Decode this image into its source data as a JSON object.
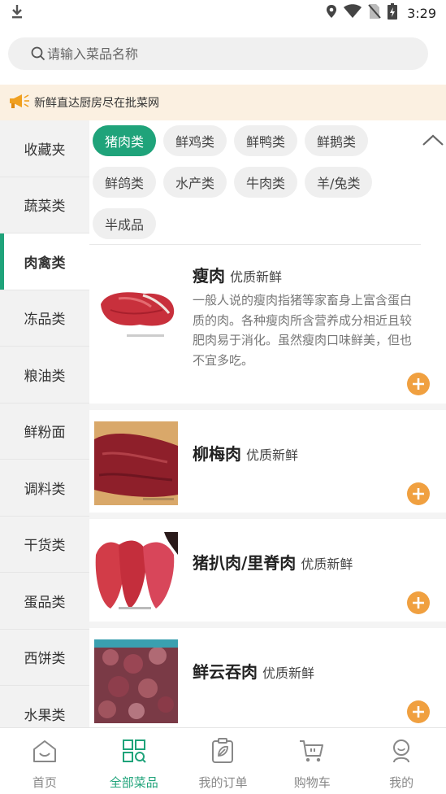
{
  "status_bar": {
    "time": "3:29"
  },
  "search": {
    "placeholder": "请输入菜品名称"
  },
  "notice": {
    "text": "新鲜直达厨房尽在批菜网"
  },
  "sidebar": {
    "items": [
      {
        "label": "收藏夹"
      },
      {
        "label": "蔬菜类"
      },
      {
        "label": "肉禽类",
        "active": true
      },
      {
        "label": "冻品类"
      },
      {
        "label": "粮油类"
      },
      {
        "label": "鲜粉面"
      },
      {
        "label": "调料类"
      },
      {
        "label": "干货类"
      },
      {
        "label": "蛋品类"
      },
      {
        "label": "西饼类"
      },
      {
        "label": "水果类"
      }
    ]
  },
  "subcategories": [
    {
      "label": "猪肉类",
      "active": true
    },
    {
      "label": "鲜鸡类"
    },
    {
      "label": "鲜鸭类"
    },
    {
      "label": "鲜鹅类"
    },
    {
      "label": "鲜鸽类"
    },
    {
      "label": "水产类"
    },
    {
      "label": "牛肉类"
    },
    {
      "label": "羊/兔类"
    },
    {
      "label": "半成品"
    }
  ],
  "products": [
    {
      "name": "瘦肉",
      "tag": "优质新鲜",
      "desc": "一般人说的瘦肉指猪等家畜身上富含蛋白质的肉。各种瘦肉所含营养成分相近且较肥肉易于消化。虽然瘦肉口味鲜美，但也不宜多吃。"
    },
    {
      "name": "柳梅肉",
      "tag": "优质新鲜",
      "desc": ""
    },
    {
      "name": "猪扒肉/里脊肉",
      "tag": "优质新鲜",
      "desc": ""
    },
    {
      "name": "鲜云吞肉",
      "tag": "优质新鲜",
      "desc": ""
    }
  ],
  "tabbar": {
    "tabs": [
      {
        "label": "首页"
      },
      {
        "label": "全部菜品",
        "active": true
      },
      {
        "label": "我的订单"
      },
      {
        "label": "购物车"
      },
      {
        "label": "我的"
      }
    ]
  },
  "colors": {
    "accent": "#1fa37a",
    "add_button": "#f0a040",
    "notice_bg": "#fbf0e1"
  }
}
